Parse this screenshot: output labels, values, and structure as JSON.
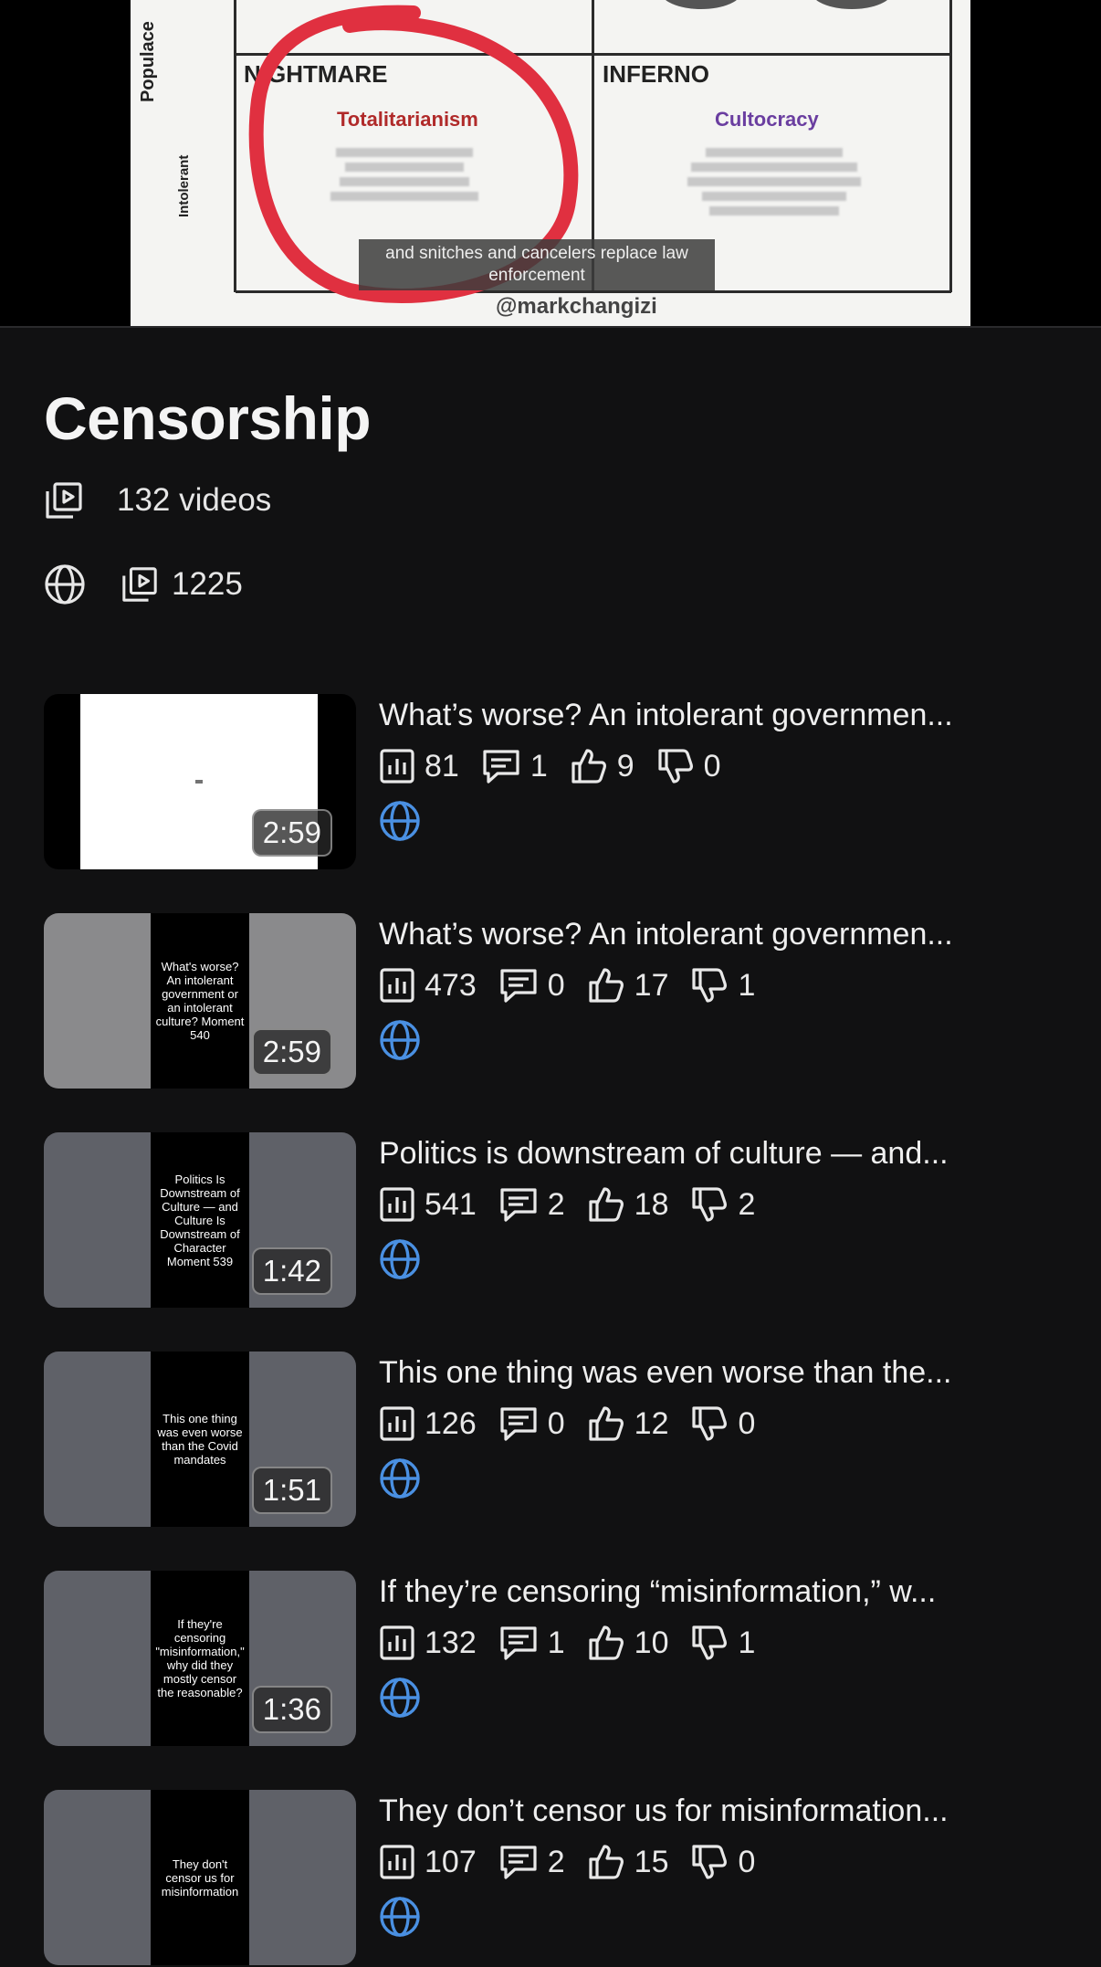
{
  "preview": {
    "y_axis_label": "Populace",
    "row_label": "Intolerant",
    "quadrant_left": "NIGHTMARE",
    "quadrant_right": "INFERNO",
    "left_heading": "Totalitarianism",
    "right_heading": "Cultocracy",
    "caption": "and snitches and cancelers replace law enforcement",
    "handle": "@markchangizi"
  },
  "playlist": {
    "title": "Censorship",
    "video_count": "132 videos",
    "total_views": "1225"
  },
  "videos": [
    {
      "title": "What’s worse? An intolerant governmen...",
      "duration": "2:59",
      "views": "81",
      "comments": "1",
      "likes": "9",
      "dislikes": "0",
      "thumb_text": ""
    },
    {
      "title": "What’s worse? An intolerant governmen...",
      "duration": "2:59",
      "views": "473",
      "comments": "0",
      "likes": "17",
      "dislikes": "1",
      "thumb_text": "What's worse? An intolerant government or an intolerant culture? Moment 540"
    },
    {
      "title": "Politics is downstream of culture — and...",
      "duration": "1:42",
      "views": "541",
      "comments": "2",
      "likes": "18",
      "dislikes": "2",
      "thumb_text": "Politics Is Downstream of Culture — and Culture Is Downstream of Character Moment 539"
    },
    {
      "title": "This one thing was even worse than the...",
      "duration": "1:51",
      "views": "126",
      "comments": "0",
      "likes": "12",
      "dislikes": "0",
      "thumb_text": "This one thing was even worse than the Covid mandates"
    },
    {
      "title": "If they’re censoring “misinformation,” w...",
      "duration": "1:36",
      "views": "132",
      "comments": "1",
      "likes": "10",
      "dislikes": "1",
      "thumb_text": "If they're censoring \"misinformation,\" why did they mostly censor the reasonable?"
    },
    {
      "title": "They don’t censor us for misinformation...",
      "duration": "",
      "views": "107",
      "comments": "2",
      "likes": "15",
      "dislikes": "0",
      "thumb_text": "They don't censor us for misinformation"
    }
  ],
  "colors": {
    "background": "#111112",
    "globe_accent": "#4a90e2",
    "text": "#efefef"
  },
  "icons": [
    "playlist-icon",
    "globe-icon",
    "views-icon",
    "comment-icon",
    "like-icon",
    "dislike-icon"
  ]
}
